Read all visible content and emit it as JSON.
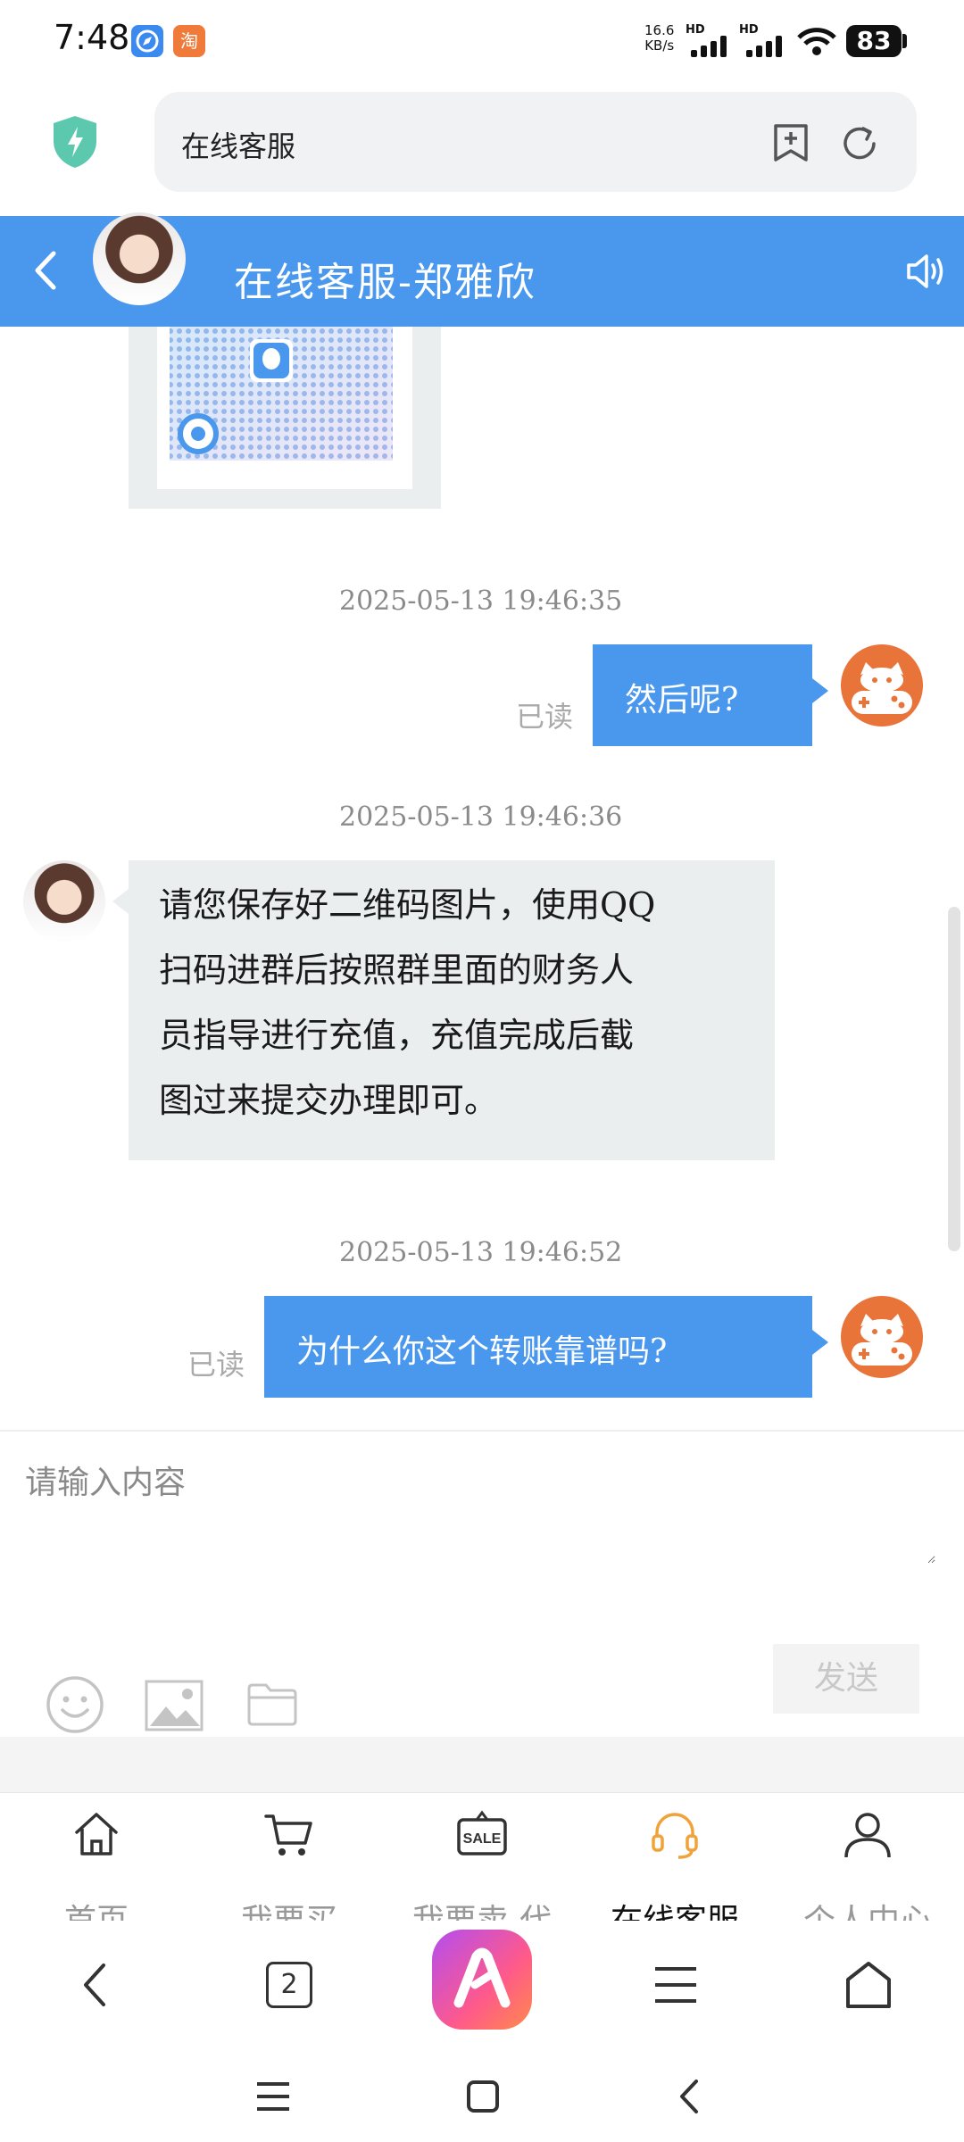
{
  "status_bar": {
    "time": "7:48",
    "app_icons": [
      "compass-app",
      "taobao-app"
    ],
    "taobao_label": "淘",
    "net_speed_value": "16.6",
    "net_speed_unit": "KB/s",
    "hd1": "HD",
    "hd2": "HD",
    "battery": "83"
  },
  "browser": {
    "address": "在线客服"
  },
  "chat": {
    "title": "在线客服-郑雅欣",
    "messages": [
      {
        "timestamp": "2025-05-13  19:46:35",
        "direction": "out",
        "text": "然后呢?",
        "read": "已读"
      },
      {
        "timestamp": "2025-05-13  19:46:36",
        "direction": "in",
        "lines": [
          "请您保存好二维码图片，使用QQ",
          "扫码进群后按照群里面的财务人",
          "员指导进行充值，充值完成后截",
          "图过来提交办理即可。"
        ]
      },
      {
        "timestamp": "2025-05-13  19:46:52",
        "direction": "out",
        "text": "为什么你这个转账靠谱吗?",
        "read": "已读"
      }
    ]
  },
  "input": {
    "placeholder": "请输入内容",
    "send_label": "发送"
  },
  "bottom_nav": {
    "items": [
      {
        "label": "首页",
        "icon": "home-icon"
      },
      {
        "label": "我要买",
        "icon": "cart-icon"
      },
      {
        "label": "我要卖-代",
        "icon": "sale-tag-icon",
        "icon_text": "SALE"
      },
      {
        "label": "在线客服",
        "icon": "headset-icon",
        "active": true
      },
      {
        "label": "个人中心",
        "icon": "person-icon"
      }
    ]
  },
  "browser_bar": {
    "tabs_count": "2"
  },
  "colors": {
    "accent": "#4a98ee",
    "active_nav_icon": "#f0a33a",
    "robot_avatar": "#e8743a"
  }
}
